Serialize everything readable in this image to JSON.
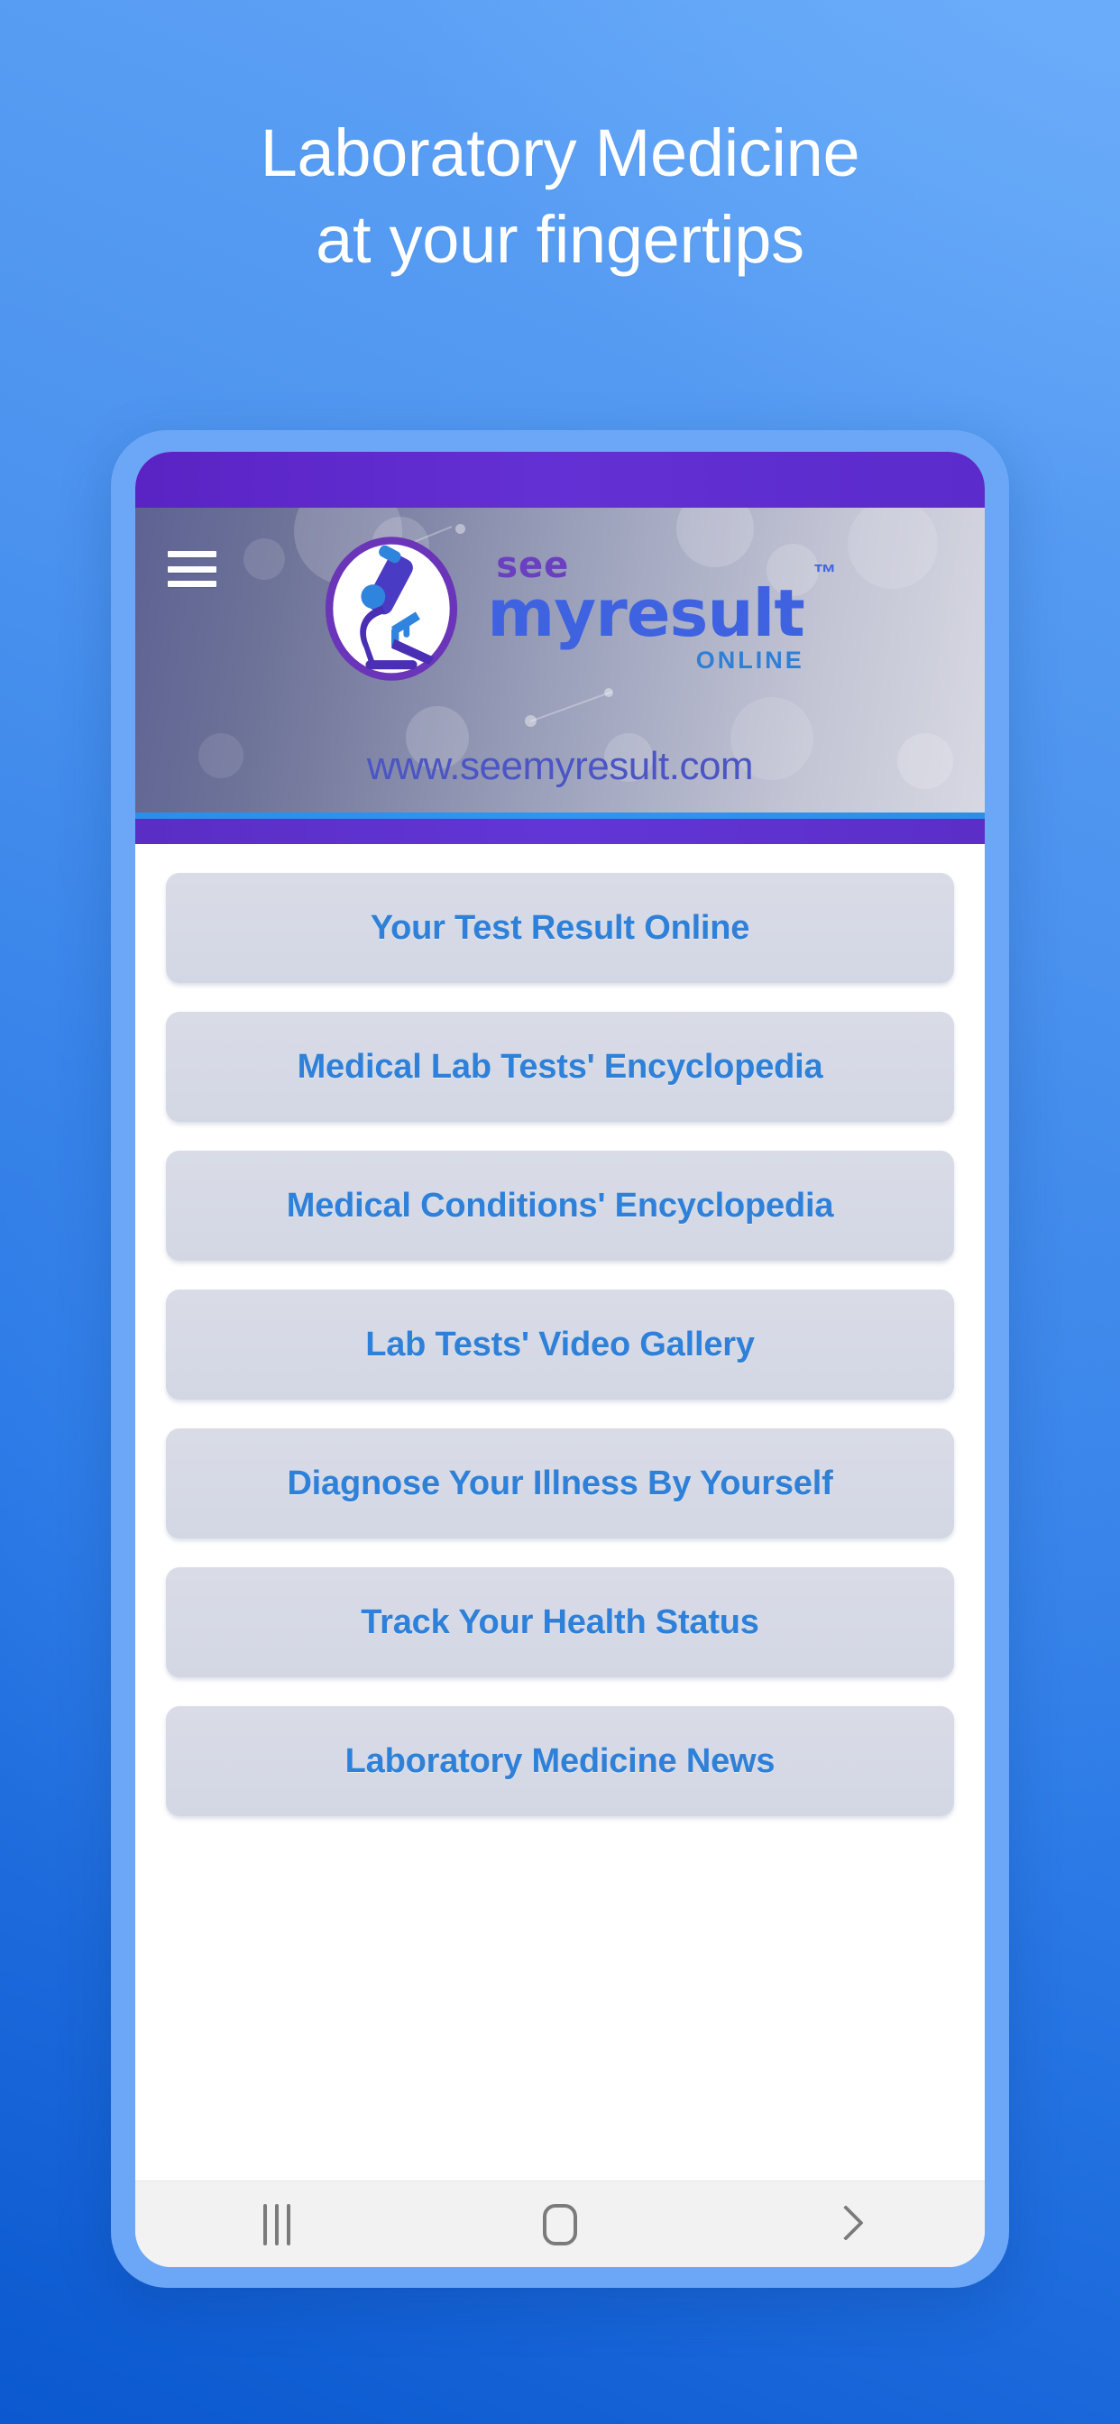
{
  "background": {
    "gradient_top_right": "#63a6f8",
    "gradient_bottom_left": "#0b58cf"
  },
  "headline": {
    "line1": "Laboratory Medicine",
    "line2": "at your fingertips",
    "color": "#ffffff"
  },
  "phone": {
    "frame_color": "#6ca7f7",
    "status_bar_color": "#5b2bcb"
  },
  "app_header": {
    "menu_icon": "hamburger-icon",
    "logo_icon": "microscope-logo-icon",
    "wordmark": {
      "see": "see",
      "main": "myresult",
      "trademark": "™",
      "online": "ONLINE"
    },
    "site_url": "www.seemyresult.com",
    "see_color": "#6a3fc0",
    "main_color": "#3f63e0",
    "online_color": "#2f7fd6",
    "url_color": "#4b55c4",
    "accent_cyan": "#2b8fe8",
    "accent_purple": "#5b2ec8"
  },
  "menu": {
    "button_bg": "#d6dae6",
    "button_text_color": "#2e80d8",
    "items": [
      {
        "label": "Your Test Result Online"
      },
      {
        "label": "Medical Lab Tests' Encyclopedia"
      },
      {
        "label": "Medical Conditions' Encyclopedia"
      },
      {
        "label": "Lab Tests' Video Gallery"
      },
      {
        "label": "Diagnose Your Illness By Yourself"
      },
      {
        "label": "Track Your Health Status"
      },
      {
        "label": "Laboratory Medicine News"
      }
    ]
  },
  "nav_bar": {
    "background": "#f2f2f2",
    "icon_color": "#7b7b7b",
    "buttons": [
      {
        "name": "recents",
        "icon": "recents-icon"
      },
      {
        "name": "home",
        "icon": "home-icon"
      },
      {
        "name": "back",
        "icon": "back-chevron-icon"
      }
    ]
  }
}
